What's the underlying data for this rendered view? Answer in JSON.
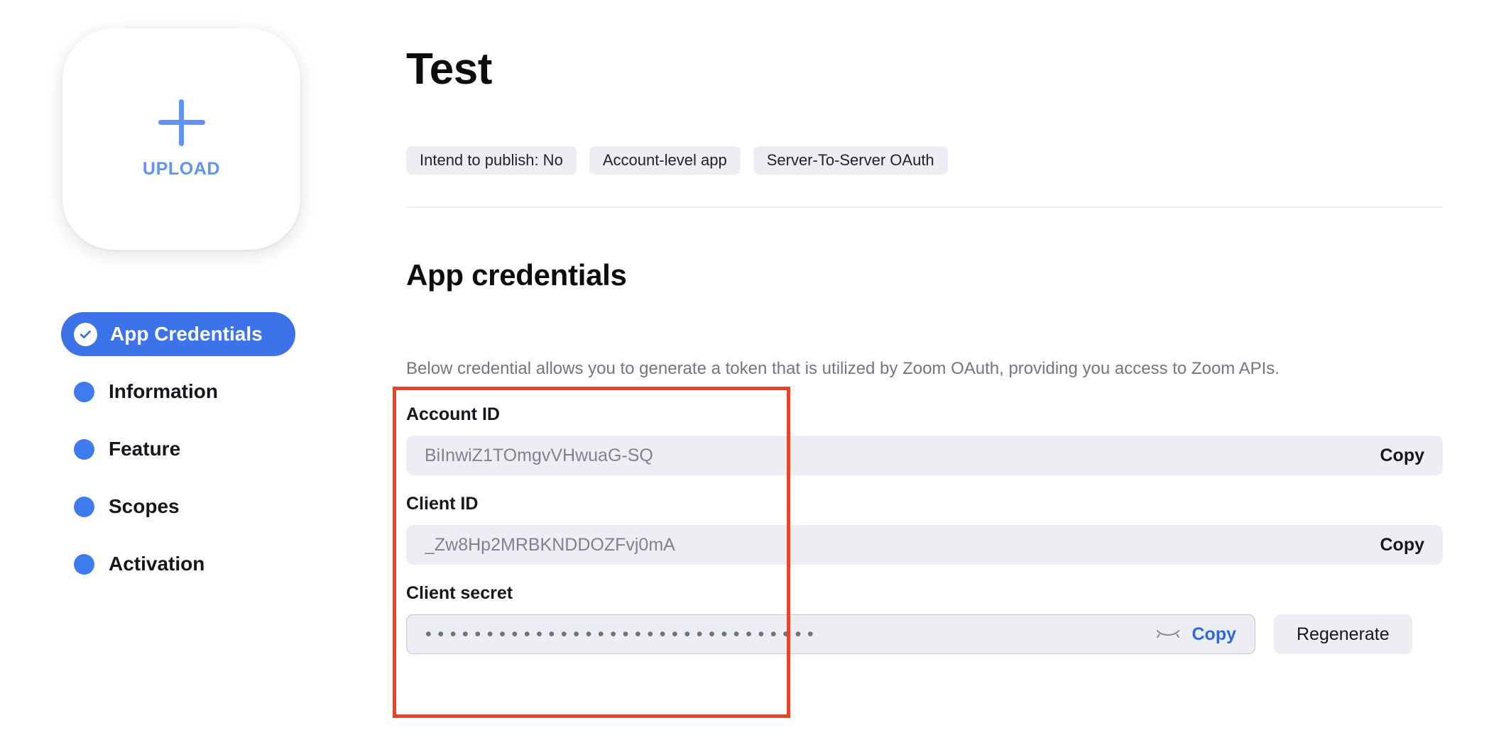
{
  "sidebar": {
    "upload": {
      "icon": "plus-icon",
      "label": "UPLOAD"
    },
    "items": [
      {
        "label": "App Credentials",
        "icon": "check-circle-icon",
        "active": true
      },
      {
        "label": "Information",
        "icon": "dot-icon",
        "active": false
      },
      {
        "label": "Feature",
        "icon": "dot-icon",
        "active": false
      },
      {
        "label": "Scopes",
        "icon": "dot-icon",
        "active": false
      },
      {
        "label": "Activation",
        "icon": "dot-icon",
        "active": false
      }
    ]
  },
  "header": {
    "title": "Test",
    "badges": [
      "Intend to publish: No",
      "Account-level app",
      "Server-To-Server OAuth"
    ]
  },
  "credentials": {
    "section_title": "App credentials",
    "description": "Below credential allows you to generate a token that is utilized by Zoom OAuth, providing you access to Zoom APIs.",
    "account_id": {
      "label": "Account ID",
      "value": "BiInwiZ1TOmgvVHwuaG-SQ",
      "copy_label": "Copy"
    },
    "client_id": {
      "label": "Client ID",
      "value": "_Zw8Hp2MRBKNDDOZFvj0mA",
      "copy_label": "Copy"
    },
    "client_secret": {
      "label": "Client secret",
      "value": "••••••••••••••••••••••••••••••••",
      "reveal_icon": "eye-closed-icon",
      "copy_label": "Copy",
      "regenerate_label": "Regenerate"
    }
  },
  "annotation": {
    "type": "highlight-rectangle",
    "color": "#EF4123"
  },
  "colors": {
    "accent_blue": "#3D7BEF",
    "link_blue": "#2D69E0",
    "upload_blue": "#5D94F5",
    "chip_bg": "#ECEEF4",
    "text_primary": "#16171C",
    "text_muted": "#74767F",
    "annotation_red": "#EF4123"
  }
}
